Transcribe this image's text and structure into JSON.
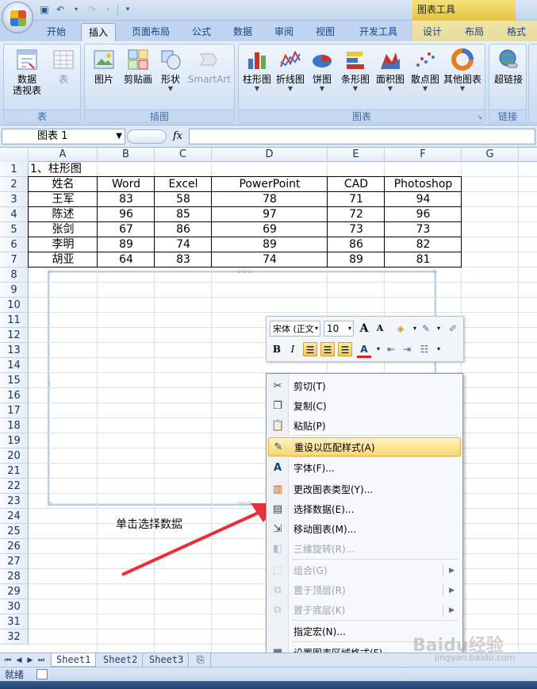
{
  "titlebar": {
    "context_title": "图表工具"
  },
  "tabs": [
    {
      "label": "开始"
    },
    {
      "label": "插入"
    },
    {
      "label": "页面布局"
    },
    {
      "label": "公式"
    },
    {
      "label": "数据"
    },
    {
      "label": "审阅"
    },
    {
      "label": "视图"
    },
    {
      "label": "开发工具"
    },
    {
      "label": "设计"
    },
    {
      "label": "布局"
    },
    {
      "label": "格式"
    }
  ],
  "ribbon": {
    "groups": [
      {
        "label": "表"
      },
      {
        "label": "插图"
      },
      {
        "label": "图表"
      },
      {
        "label": "链接"
      }
    ],
    "buttons": {
      "pivot": "数据",
      "pivot2": "透视表",
      "table": "表",
      "picture": "图片",
      "clipart": "剪贴画",
      "shapes": "形状",
      "smartart": "SmartArt",
      "column": "柱形图",
      "line": "折线图",
      "pie": "饼图",
      "bar": "条形图",
      "area": "面积图",
      "scatter": "散点图",
      "other": "其他图表",
      "hyperlink": "超链接"
    }
  },
  "formulabar": {
    "name_box": "图表 1",
    "fx": "fx"
  },
  "sheet": {
    "columns": [
      "A",
      "B",
      "C",
      "D",
      "E",
      "F",
      "G"
    ],
    "rows": [
      "1",
      "2",
      "3",
      "4",
      "5",
      "6",
      "7",
      "8",
      "9",
      "10",
      "11",
      "12",
      "13",
      "14",
      "15",
      "16",
      "17",
      "18",
      "19",
      "20",
      "21",
      "22",
      "23",
      "24",
      "25",
      "26",
      "27",
      "28",
      "29",
      "30",
      "31",
      "32"
    ],
    "title_cell": "1、柱形图",
    "table_header": [
      "姓名",
      "Word",
      "Excel",
      "PowerPoint",
      "CAD",
      "Photoshop"
    ],
    "table_rows": [
      [
        "王军",
        "83",
        "58",
        "78",
        "71",
        "94"
      ],
      [
        "陈述",
        "96",
        "85",
        "97",
        "72",
        "96"
      ],
      [
        "张剑",
        "67",
        "86",
        "69",
        "73",
        "73"
      ],
      [
        "李明",
        "89",
        "74",
        "89",
        "86",
        "82"
      ],
      [
        "胡亚",
        "64",
        "83",
        "74",
        "89",
        "81"
      ]
    ],
    "annotation": "单击选择数据"
  },
  "minitoolbar": {
    "font": "宋体 (正文",
    "size": "10"
  },
  "context_menu": [
    {
      "label": "剪切(T)",
      "icon": "scissors-icon"
    },
    {
      "label": "复制(C)",
      "icon": "copy-icon"
    },
    {
      "label": "粘贴(P)",
      "icon": "paste-icon"
    },
    {
      "label": "重设以匹配样式(A)",
      "icon": "reset-style-icon"
    },
    {
      "label": "字体(F)...",
      "icon": "font-icon"
    },
    {
      "label": "更改图表类型(Y)...",
      "icon": "chart-type-icon"
    },
    {
      "label": "选择数据(E)...",
      "icon": "select-data-icon"
    },
    {
      "label": "移动图表(M)...",
      "icon": "move-chart-icon"
    },
    {
      "label": "三维旋转(R)...",
      "icon": "rotate-3d-icon"
    },
    {
      "label": "组合(G)",
      "icon": "group-icon"
    },
    {
      "label": "置于顶层(R)",
      "icon": "bring-front-icon"
    },
    {
      "label": "置于底层(K)",
      "icon": "send-back-icon"
    },
    {
      "label": "指定宏(N)...",
      "icon": "macro-icon"
    },
    {
      "label": "设置图表区域格式(F)...",
      "icon": "format-chart-area-icon"
    }
  ],
  "sheet_tabs": [
    {
      "label": "Sheet1"
    },
    {
      "label": "Sheet2"
    },
    {
      "label": "Sheet3"
    }
  ],
  "status": {
    "text": "就绪"
  },
  "watermark": {
    "brand": "Baidu经验",
    "url": "jingyan.baidu.com"
  }
}
